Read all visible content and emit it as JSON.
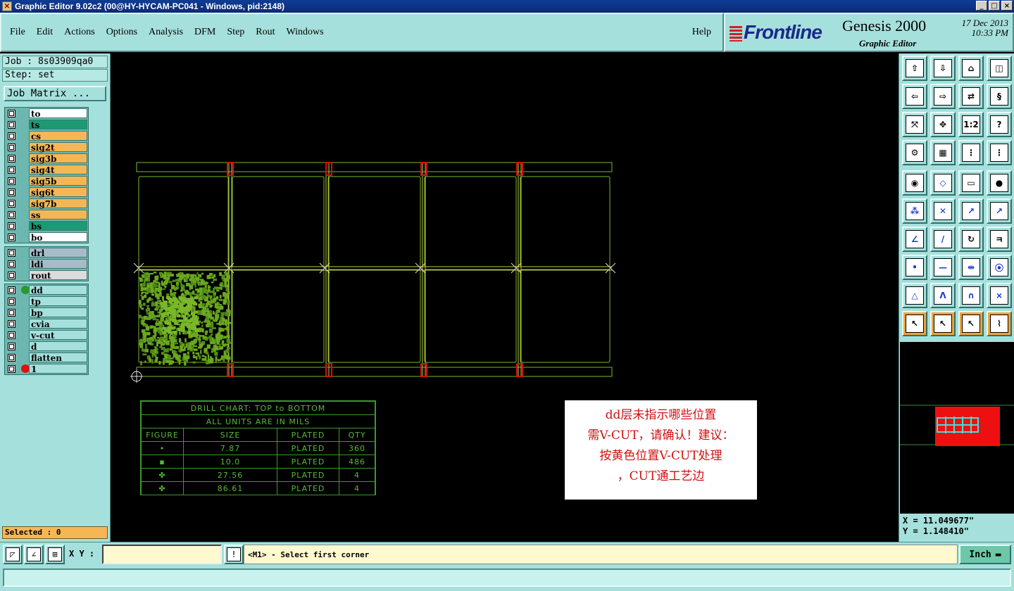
{
  "window": {
    "title": "Graphic Editor 9.02c2 (00@HY-HYCAM-PC041 - Windows, pid:2148)",
    "controls": [
      "_",
      "□",
      "×"
    ]
  },
  "menu": {
    "items": [
      "File",
      "Edit",
      "Actions",
      "Options",
      "Analysis",
      "DFM",
      "Step",
      "Rout",
      "Windows"
    ],
    "help": "Help"
  },
  "brand": {
    "logo": "Frontline",
    "product": "Genesis 2000",
    "subtitle": "Graphic Editor",
    "date": "17 Dec 2013",
    "time": "10:33 PM"
  },
  "job": {
    "job_label": "Job : 8s03909qa0",
    "step_label": "Step: set",
    "matrix_button": "Job Matrix ..."
  },
  "layers": {
    "group1": [
      {
        "name": "to",
        "color": "#ffffff"
      },
      {
        "name": "ts",
        "color": "#1d9a73"
      },
      {
        "name": "cs",
        "color": "#f5b756"
      },
      {
        "name": "sig2t",
        "color": "#f5b756"
      },
      {
        "name": "sig3b",
        "color": "#f5b756"
      },
      {
        "name": "sig4t",
        "color": "#f5b756"
      },
      {
        "name": "sig5b",
        "color": "#f5b756"
      },
      {
        "name": "sig6t",
        "color": "#f5b756"
      },
      {
        "name": "sig7b",
        "color": "#f5b756"
      },
      {
        "name": "ss",
        "color": "#f5b756"
      },
      {
        "name": "bs",
        "color": "#1d9a73"
      },
      {
        "name": "bo",
        "color": "#ffffff"
      }
    ],
    "group2": [
      {
        "name": "drl",
        "color": "#a8bcc8"
      },
      {
        "name": "ldi",
        "color": "#a8bcc8"
      },
      {
        "name": "rout",
        "color": "#dcdcdc"
      }
    ],
    "group3": [
      {
        "name": "dd",
        "color": "#a6e0dc"
      },
      {
        "name": "tp",
        "color": "#a6e0dc"
      },
      {
        "name": "bp",
        "color": "#a6e0dc"
      },
      {
        "name": "cvia",
        "color": "#a6e0dc"
      },
      {
        "name": "v-cut",
        "color": "#a6e0dc"
      },
      {
        "name": "d",
        "color": "#a6e0dc"
      },
      {
        "name": "flatten",
        "color": "#a6e0dc"
      },
      {
        "name": "1",
        "color": "#a6e0dc"
      }
    ]
  },
  "selected_label": "Selected : 0",
  "drill_chart": {
    "title": "DRILL CHART: TOP to BOTTOM",
    "subtitle": "ALL UNITS ARE IN MILS",
    "headers": [
      "FIGURE",
      "SIZE",
      "PLATED",
      "QTY"
    ],
    "rows": [
      {
        "figure": "•",
        "size": "7.87",
        "plated": "PLATED",
        "qty": "360"
      },
      {
        "figure": "▪",
        "size": "10.0",
        "plated": "PLATED",
        "qty": "486"
      },
      {
        "figure": "✤",
        "size": "27.56",
        "plated": "PLATED",
        "qty": "4"
      },
      {
        "figure": "✤",
        "size": "86.61",
        "plated": "PLATED",
        "qty": "4"
      }
    ]
  },
  "note": {
    "lines": [
      "dd层未指示哪些位置",
      "需V-CUT，请确认！建议：",
      "按黄色位置V-CUT处理",
      "，CUT通工艺边"
    ]
  },
  "coords": {
    "x": "X = 11.049677\"",
    "y": "Y = 1.148410\""
  },
  "bottom": {
    "xy_label": "X Y :",
    "prompt": "<M1> - Select first corner",
    "unit": "Inch"
  },
  "colors": {
    "panel": "#a6e0dc",
    "board_line": "#7ab82a",
    "vcut_yellow": "#c8c840",
    "red_marker": "#d01010"
  }
}
